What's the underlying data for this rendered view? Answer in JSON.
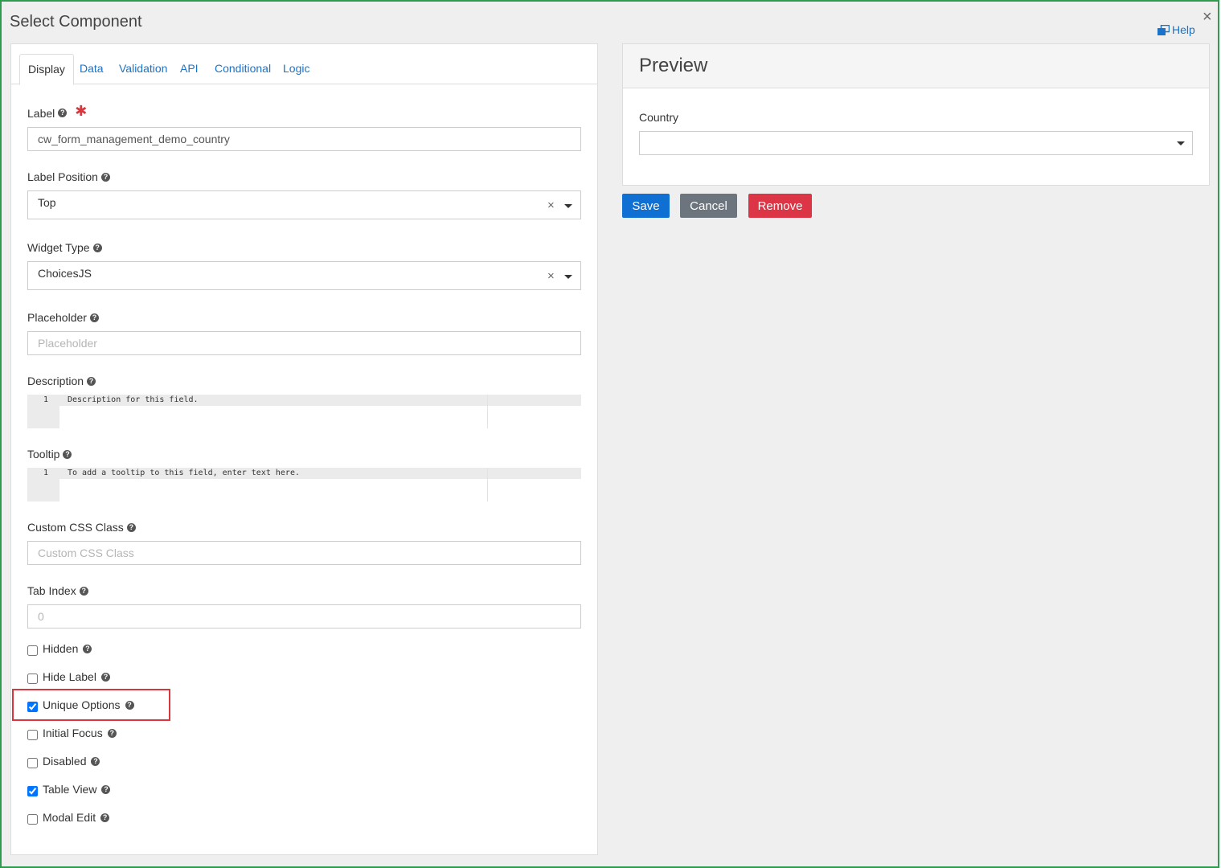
{
  "dialog": {
    "title": "Select Component",
    "close_glyph": "×",
    "help_label": "Help"
  },
  "tabs": [
    {
      "label": "Display",
      "active": true
    },
    {
      "label": "Data"
    },
    {
      "label": "Validation"
    },
    {
      "label": "API"
    },
    {
      "label": "Conditional"
    },
    {
      "label": "Logic"
    }
  ],
  "fields": {
    "label": {
      "label": "Label",
      "value": "cw_form_management_demo_country",
      "required_mark": "✱"
    },
    "label_position": {
      "label": "Label Position",
      "value": "Top"
    },
    "widget_type": {
      "label": "Widget Type",
      "value": "ChoicesJS"
    },
    "placeholder": {
      "label": "Placeholder",
      "placeholder": "Placeholder"
    },
    "description": {
      "label": "Description",
      "line_number": "1",
      "code": "Description for this field."
    },
    "tooltip": {
      "label": "Tooltip",
      "line_number": "1",
      "code": "To add a tooltip to this field, enter text here."
    },
    "custom_css": {
      "label": "Custom CSS Class",
      "placeholder": "Custom CSS Class"
    },
    "tab_index": {
      "label": "Tab Index",
      "placeholder": "0"
    }
  },
  "checkboxes": [
    {
      "label": "Hidden",
      "checked": false
    },
    {
      "label": "Hide Label",
      "checked": false
    },
    {
      "label": "Unique Options",
      "checked": true
    },
    {
      "label": "Initial Focus",
      "checked": false
    },
    {
      "label": "Disabled",
      "checked": false
    },
    {
      "label": "Table View",
      "checked": true
    },
    {
      "label": "Modal Edit",
      "checked": false
    }
  ],
  "preview": {
    "title": "Preview",
    "field_label": "Country"
  },
  "buttons": {
    "save": "Save",
    "cancel": "Cancel",
    "remove": "Remove"
  },
  "colors": {
    "dialog_border": "#2e9b4e",
    "link": "#1a73c8",
    "save": "#0f6fd3",
    "cancel": "#6c757d",
    "remove": "#dc3545",
    "highlight": "#d9363e"
  },
  "icons": {
    "help": "external-window-icon",
    "tooltip": "question-circle-icon",
    "clear": "clear-x-icon",
    "dropdown": "caret-down-icon"
  }
}
